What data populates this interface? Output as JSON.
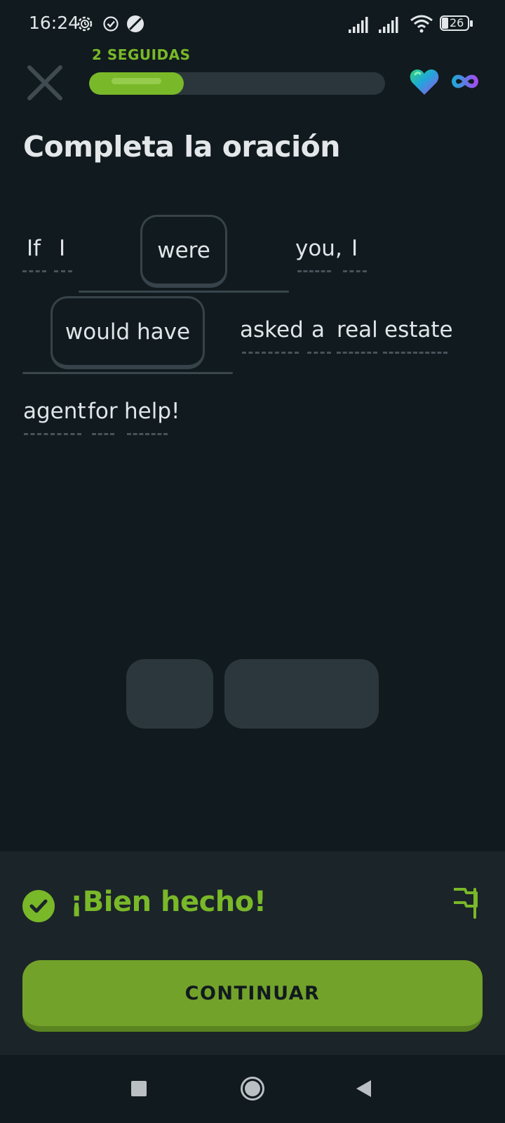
{
  "status_bar": {
    "time": "16:24",
    "battery": "26",
    "icons": [
      "settings-sync-icon",
      "check-circle-icon",
      "no-disturb-icon",
      "signal-icon",
      "signal-icon",
      "wifi-icon",
      "battery-icon"
    ]
  },
  "header": {
    "streak_label": "2 SEGUIDAS",
    "progress_fraction": 0.32,
    "hearts_icon": "heart-icon",
    "hearts_value_icon": "infinity-icon",
    "close_icon": "close-icon"
  },
  "exercise": {
    "title": "Completa la oración",
    "words": {
      "w1": "If",
      "w2": "I",
      "w3": "you,",
      "w4": "I",
      "w5": "asked",
      "w6": "a",
      "w7": "real",
      "w8": "estate",
      "w9": "agent",
      "w10": "for",
      "w11": "help!"
    },
    "chips": [
      "were",
      "would have"
    ]
  },
  "word_bank": {
    "used_slots": 2
  },
  "feedback": {
    "message": "¡Bien hecho!",
    "continue_label": "CONTINUAR",
    "accent_color": "#79b829"
  },
  "nav_bar": {
    "icons": [
      "recents-icon",
      "home-icon",
      "back-icon"
    ]
  },
  "colors": {
    "background": "#111a1e",
    "panel": "#1b2429",
    "accent_green": "#79b829",
    "button_green": "#73a22a"
  }
}
